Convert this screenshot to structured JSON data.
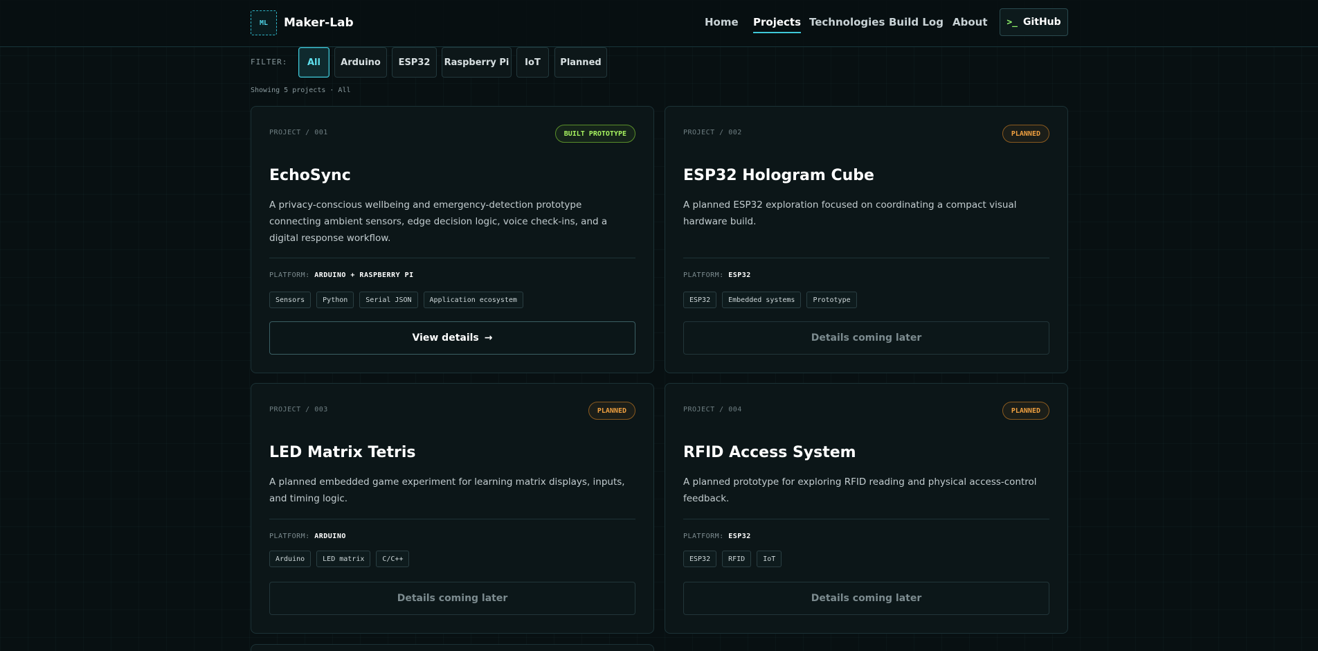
{
  "header": {
    "logo_mark": "ML",
    "logo_text": "Maker-Lab",
    "nav": [
      {
        "label": "Home",
        "active": false
      },
      {
        "label": "Projects",
        "active": true
      },
      {
        "label": "Technologies",
        "active": false
      },
      {
        "label": "Build Log",
        "active": false
      },
      {
        "label": "About",
        "active": false
      }
    ],
    "github_icon": ">_",
    "github_label": "GitHub"
  },
  "filter": {
    "label": "FILTER:",
    "chips": [
      "All",
      "Arduino",
      "ESP32",
      "Raspberry Pi",
      "IoT",
      "Planned"
    ],
    "active": "All",
    "showing": "Showing 5 projects · All"
  },
  "projects": [
    {
      "id": "PROJECT / 001",
      "status": "BUILT PROTOTYPE",
      "title": "EchoSync",
      "description": "A privacy-conscious wellbeing and emergency-detection prototype connecting ambient sensors, edge decision logic, voice check-ins, and a digital response workflow.",
      "platform_label": "PLATFORM:",
      "platform": "ARDUINO + RASPBERRY PI",
      "tags": [
        "Sensors",
        "Python",
        "Serial JSON",
        "Application ecosystem"
      ],
      "button": "View details",
      "button_arrow": "→"
    },
    {
      "id": "PROJECT / 002",
      "status": "PLANNED",
      "title": "ESP32 Hologram Cube",
      "description": "A planned ESP32 exploration focused on coordinating a compact visual hardware build.",
      "platform_label": "PLATFORM:",
      "platform": "ESP32",
      "tags": [
        "ESP32",
        "Embedded systems",
        "Prototype"
      ],
      "button": "Details coming later"
    },
    {
      "id": "PROJECT / 003",
      "status": "PLANNED",
      "title": "LED Matrix Tetris",
      "description": "A planned embedded game experiment for learning matrix displays, inputs, and timing logic.",
      "platform_label": "PLATFORM:",
      "platform": "ARDUINO",
      "tags": [
        "Arduino",
        "LED matrix",
        "C/C++"
      ],
      "button": "Details coming later"
    },
    {
      "id": "PROJECT / 004",
      "status": "PLANNED",
      "title": "RFID Access System",
      "description": "A planned prototype for exploring RFID reading and physical access-control feedback.",
      "platform_label": "PLATFORM:",
      "platform": "ESP32",
      "tags": [
        "ESP32",
        "RFID",
        "IoT"
      ],
      "button": "Details coming later"
    }
  ]
}
